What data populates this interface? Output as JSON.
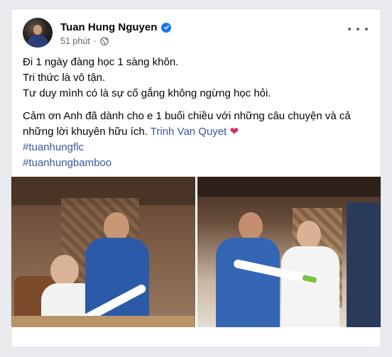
{
  "post": {
    "author": "Tuan Hung Nguyen",
    "time": "51 phút",
    "lines": [
      "Đi 1 ngày đàng học 1 sàng khôn.",
      "Tri thức là vô tận.",
      "Tư duy mình có là sự cố gắng không ngừng học hỏi."
    ],
    "thanks_text": "Cảm ơn Anh đã dành cho e 1 buổi chiều với những câu chuyện và cả những lời khuyên hữu ích.",
    "mention": "Trinh Van Quyet",
    "heart": "❤",
    "hashtags": [
      "#tuanhungflc",
      "#tuanhungbamboo"
    ]
  },
  "icons": {
    "verified": "verified-badge-icon",
    "privacy": "globe-icon",
    "more": "more-options-icon"
  },
  "colors": {
    "link": "#385898",
    "verified": "#1877f2",
    "meta": "#65676b",
    "heart": "#e0245e"
  }
}
